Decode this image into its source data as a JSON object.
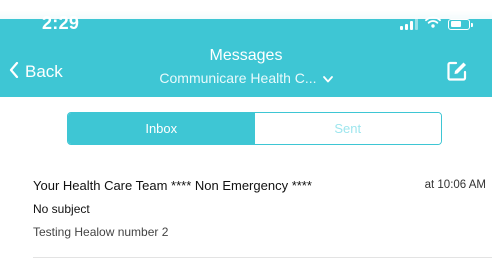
{
  "status_bar": {
    "time": "2:29"
  },
  "nav": {
    "back_label": "Back",
    "title": "Messages",
    "subtitle": "Communicare Health C..."
  },
  "tabs": [
    {
      "label": "Inbox",
      "active": true
    },
    {
      "label": "Sent",
      "active": false
    }
  ],
  "messages": [
    {
      "sender": "Your Health Care Team **** Non Emergency ****",
      "time": "at 10:06 AM",
      "subject": "No subject",
      "preview": "Testing Healow number 2"
    }
  ],
  "colors": {
    "accent": "#3ec6d4",
    "text": "#111111",
    "inactive_tab_text": "#9ee6ee"
  },
  "icons": {
    "back": "chevron-left-icon",
    "subtitle_dropdown": "chevron-down-icon",
    "compose": "compose-icon",
    "signal": "signal-icon",
    "wifi": "wifi-icon",
    "battery": "battery-icon"
  }
}
